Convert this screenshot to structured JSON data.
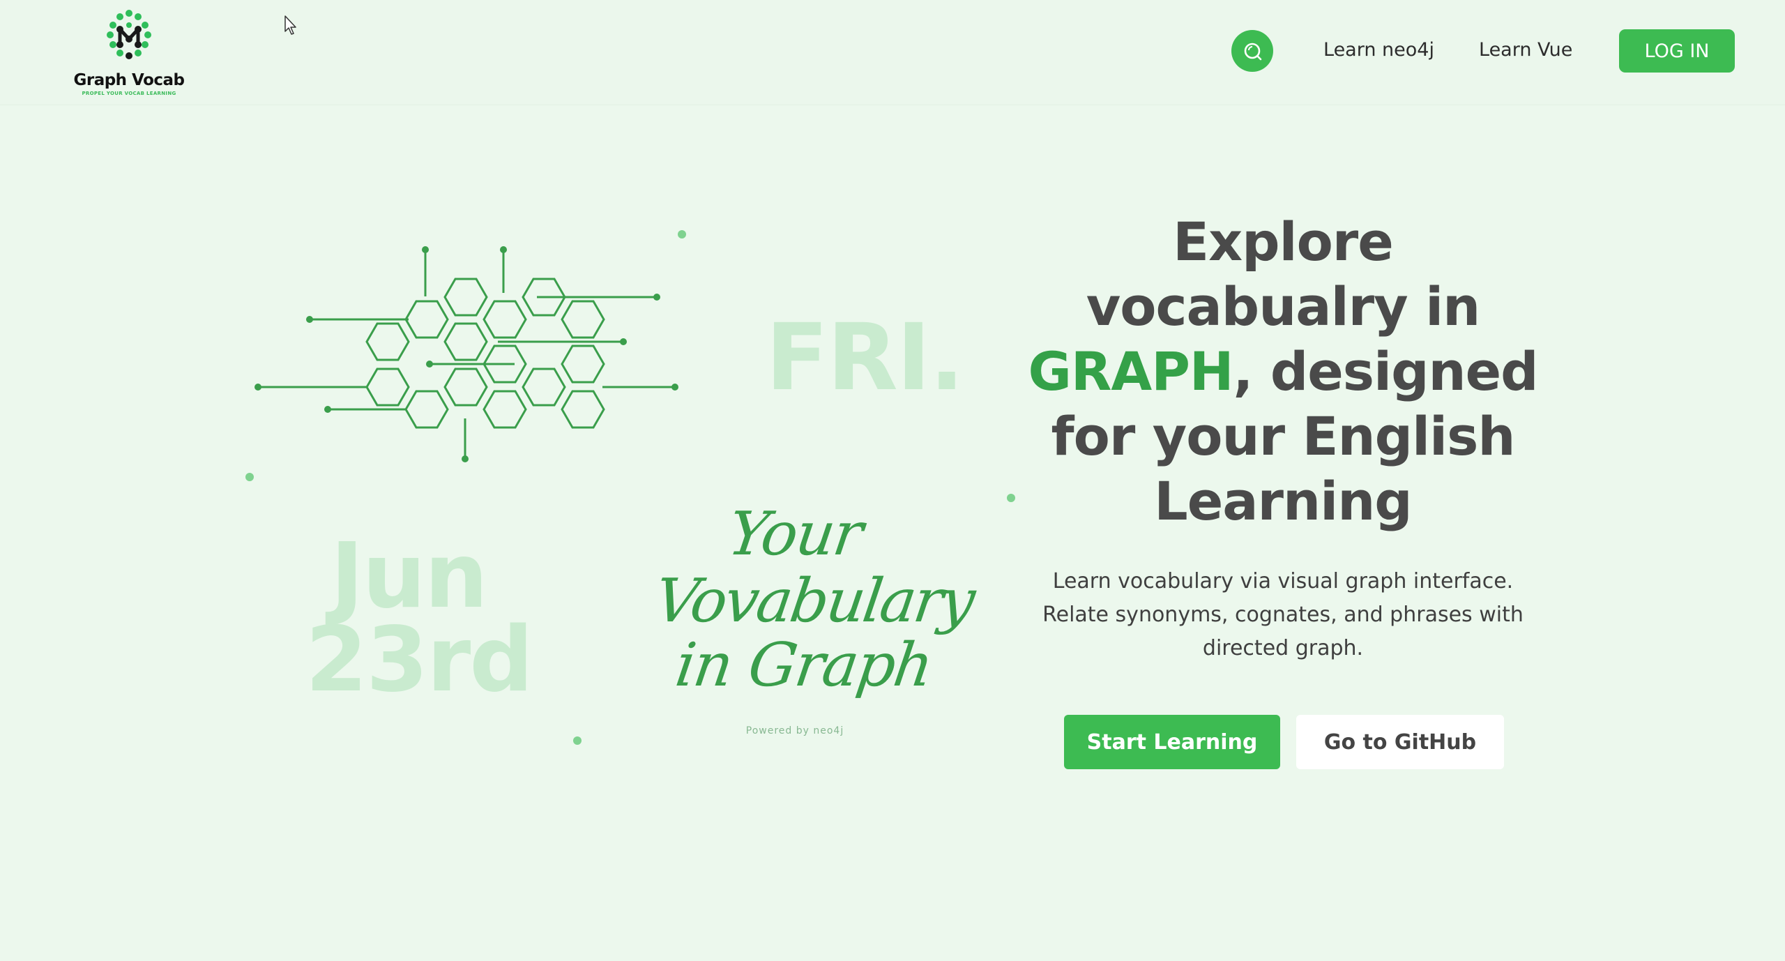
{
  "header": {
    "logo": {
      "name": "Graph Vocab",
      "tagline": "PROPEL YOUR VOCAB LEARNING"
    },
    "nav": {
      "search_icon": "search-icon",
      "links": [
        "Learn neo4j",
        "Learn Vue"
      ],
      "login_label": "LOG IN"
    }
  },
  "hero": {
    "art": {
      "day": "FRI.",
      "date_line1": "Jun",
      "date_line2": "23rd",
      "script_line1": "Your",
      "script_line2": "Vovabulary",
      "script_line3": "in Graph",
      "powered_by": "Powered by neo4j"
    },
    "headline": {
      "line1": "Explore",
      "line2": "vocabualry in",
      "accent": "GRAPH",
      "line3_rest": ", designed",
      "line4": "for your English",
      "line5": "Learning"
    },
    "subtext": "Learn vocabulary via visual graph interface. Relate synonyms, cognates, and phrases with directed graph.",
    "buttons": {
      "primary": "Start Learning",
      "secondary": "Go to GitHub"
    }
  },
  "colors": {
    "background": "#ecf8ed",
    "accent": "#3dbb52",
    "accent_dark": "#34a148",
    "text": "#4a4a4a",
    "faint": "#c9ebcf"
  }
}
